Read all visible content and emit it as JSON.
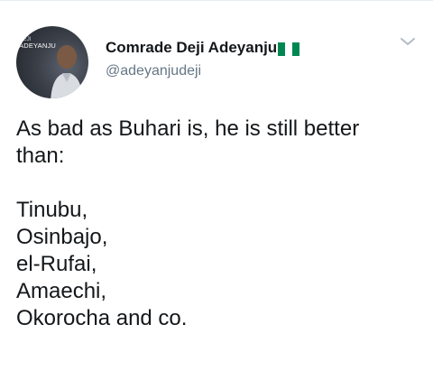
{
  "tweet": {
    "author": {
      "display_name": "Comrade Deji Adeyanju",
      "handle": "@adeyanjudeji",
      "avatar_text_small": "DEJI",
      "avatar_text": "ADEYANJU",
      "flag_icon": "nigeria-flag-icon",
      "flag_colors": [
        "#008751",
        "#ffffff",
        "#008751"
      ]
    },
    "menu_icon": "chevron-down-icon",
    "text_intro_line1": "As bad as Buhari is, he is still better",
    "text_intro_line2": "than:",
    "names": [
      "Tinubu,",
      "Osinbajo,",
      "el-Rufai,",
      "Amaechi,",
      "Okorocha and co."
    ]
  }
}
